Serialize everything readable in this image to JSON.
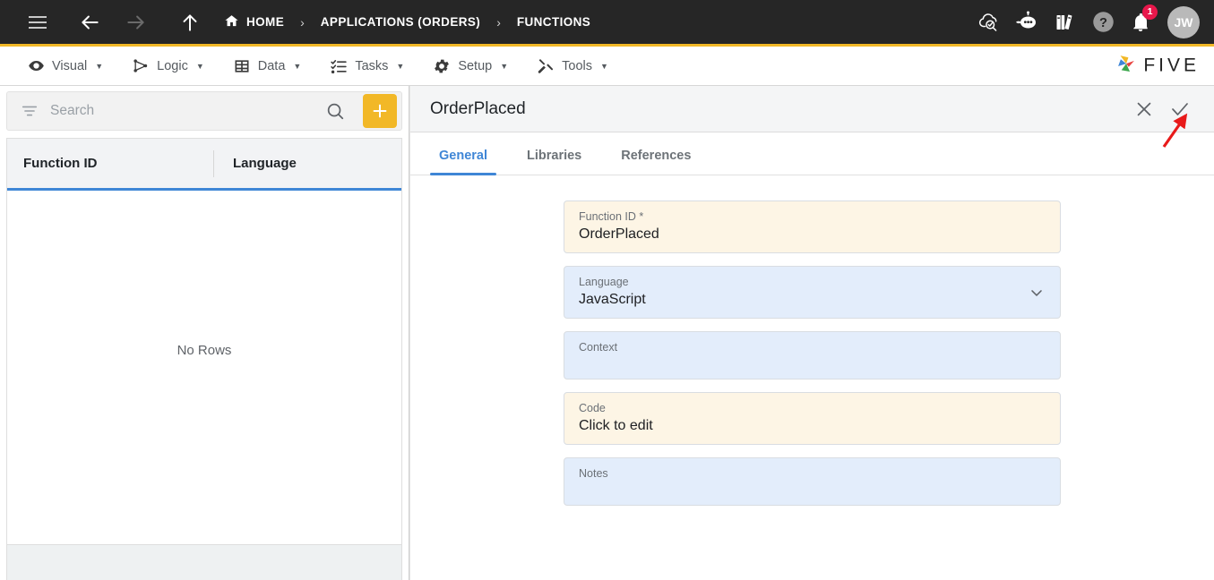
{
  "topbar": {
    "menu_icon": "hamburger-icon",
    "back_icon": "arrow-left-icon",
    "forward_icon": "arrow-right-icon",
    "up_icon": "arrow-up-icon",
    "breadcrumbs": [
      {
        "label": "HOME",
        "icon": "home-icon"
      },
      {
        "label": "APPLICATIONS (ORDERS)",
        "icon": ""
      },
      {
        "label": "FUNCTIONS",
        "icon": ""
      }
    ],
    "separator": "›",
    "actions": [
      {
        "name": "cloud-search-icon",
        "label": ""
      },
      {
        "name": "chatbot-icon",
        "label": ""
      },
      {
        "name": "books-icon",
        "label": ""
      },
      {
        "name": "help-icon",
        "label": ""
      },
      {
        "name": "notifications-bell-icon",
        "label": ""
      }
    ],
    "notification_count": "1",
    "avatar_initials": "JW",
    "accent_bar_color": "#f2b827",
    "background_color": "#262626"
  },
  "menubar": {
    "items": [
      {
        "label": "Visual",
        "icon": "eye-icon",
        "caret": "▼"
      },
      {
        "label": "Logic",
        "icon": "network-nodes-icon",
        "caret": "▼"
      },
      {
        "label": "Data",
        "icon": "table-grid-icon",
        "caret": "▼"
      },
      {
        "label": "Tasks",
        "icon": "checklist-icon",
        "caret": "▼"
      },
      {
        "label": "Setup",
        "icon": "gear-icon",
        "caret": "▼"
      },
      {
        "label": "Tools",
        "icon": "tools-icon",
        "caret": "▼"
      }
    ],
    "brand_text": "FIVE",
    "brand_logo": "five-pinwheel-logo"
  },
  "left_panel": {
    "search": {
      "placeholder": "Search",
      "value": "",
      "filter_icon": "filter-icon",
      "search_icon": "search-icon"
    },
    "add_button": {
      "label": "+",
      "color": "#f2b827"
    },
    "grid": {
      "columns": [
        "Function ID",
        "Language"
      ],
      "rows": [],
      "empty_message": "No Rows",
      "header_underline_color": "#3f86d6"
    }
  },
  "right_panel": {
    "title": "OrderPlaced",
    "close_icon": "close-icon",
    "save_icon": "checkmark-icon",
    "tabs": [
      {
        "label": "General",
        "active": true
      },
      {
        "label": "Libraries",
        "active": false
      },
      {
        "label": "References",
        "active": false
      }
    ],
    "active_tab_color": "#3f86d6",
    "fields": [
      {
        "label": "Function ID *",
        "value": "OrderPlaced",
        "style": "cream",
        "control": "text"
      },
      {
        "label": "Language",
        "value": "JavaScript",
        "style": "blue",
        "control": "select"
      },
      {
        "label": "Context",
        "value": "",
        "style": "blue",
        "control": "text"
      },
      {
        "label": "Code",
        "value": "Click to edit",
        "style": "cream",
        "control": "text"
      },
      {
        "label": "Notes",
        "value": "",
        "style": "blue",
        "control": "text"
      }
    ]
  },
  "annotation": {
    "arrow_color": "#e81a1a",
    "points_to": "save-checkmark-button"
  }
}
